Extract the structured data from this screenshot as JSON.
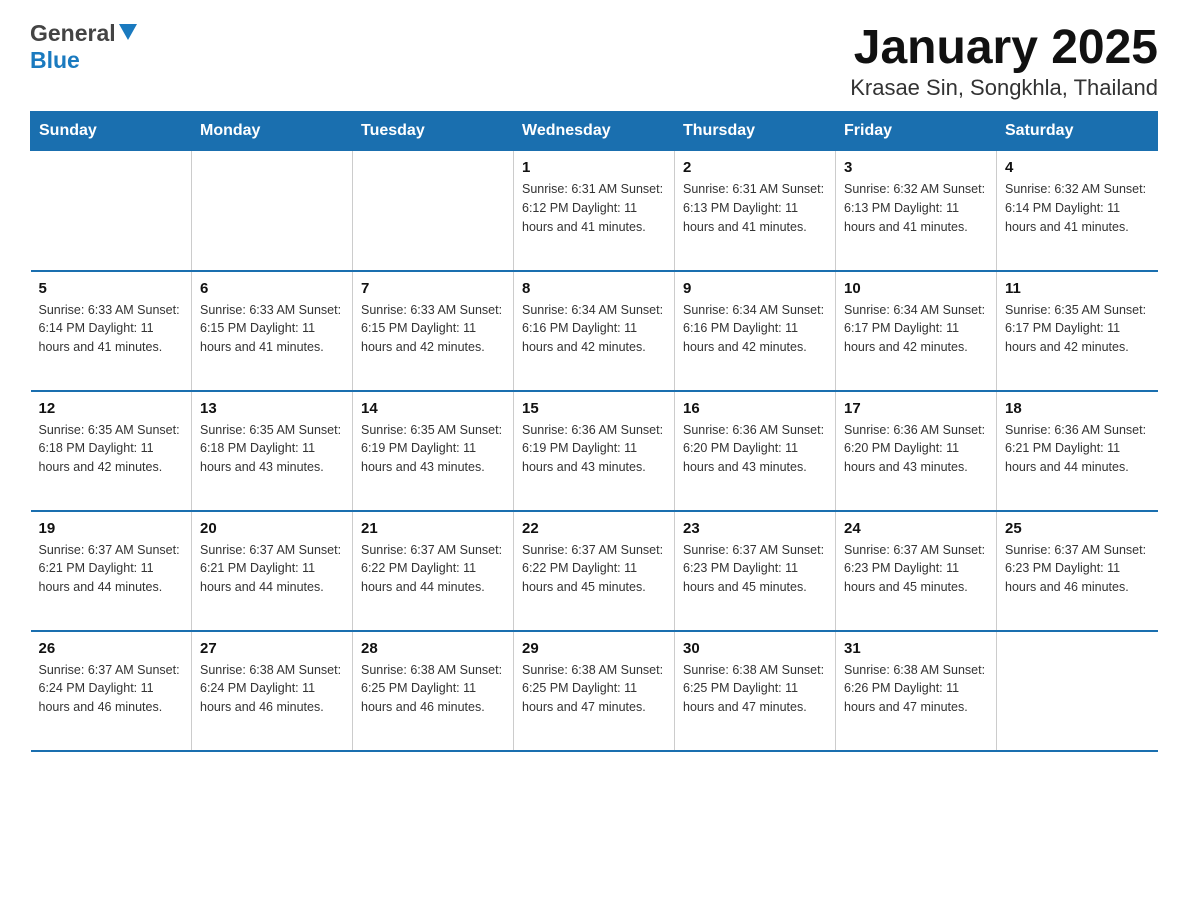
{
  "header": {
    "logo_general": "General",
    "logo_blue": "Blue",
    "title": "January 2025",
    "subtitle": "Krasae Sin, Songkhla, Thailand"
  },
  "days_of_week": [
    "Sunday",
    "Monday",
    "Tuesday",
    "Wednesday",
    "Thursday",
    "Friday",
    "Saturday"
  ],
  "weeks": [
    [
      {
        "day": "",
        "info": ""
      },
      {
        "day": "",
        "info": ""
      },
      {
        "day": "",
        "info": ""
      },
      {
        "day": "1",
        "info": "Sunrise: 6:31 AM\nSunset: 6:12 PM\nDaylight: 11 hours and 41 minutes."
      },
      {
        "day": "2",
        "info": "Sunrise: 6:31 AM\nSunset: 6:13 PM\nDaylight: 11 hours and 41 minutes."
      },
      {
        "day": "3",
        "info": "Sunrise: 6:32 AM\nSunset: 6:13 PM\nDaylight: 11 hours and 41 minutes."
      },
      {
        "day": "4",
        "info": "Sunrise: 6:32 AM\nSunset: 6:14 PM\nDaylight: 11 hours and 41 minutes."
      }
    ],
    [
      {
        "day": "5",
        "info": "Sunrise: 6:33 AM\nSunset: 6:14 PM\nDaylight: 11 hours and 41 minutes."
      },
      {
        "day": "6",
        "info": "Sunrise: 6:33 AM\nSunset: 6:15 PM\nDaylight: 11 hours and 41 minutes."
      },
      {
        "day": "7",
        "info": "Sunrise: 6:33 AM\nSunset: 6:15 PM\nDaylight: 11 hours and 42 minutes."
      },
      {
        "day": "8",
        "info": "Sunrise: 6:34 AM\nSunset: 6:16 PM\nDaylight: 11 hours and 42 minutes."
      },
      {
        "day": "9",
        "info": "Sunrise: 6:34 AM\nSunset: 6:16 PM\nDaylight: 11 hours and 42 minutes."
      },
      {
        "day": "10",
        "info": "Sunrise: 6:34 AM\nSunset: 6:17 PM\nDaylight: 11 hours and 42 minutes."
      },
      {
        "day": "11",
        "info": "Sunrise: 6:35 AM\nSunset: 6:17 PM\nDaylight: 11 hours and 42 minutes."
      }
    ],
    [
      {
        "day": "12",
        "info": "Sunrise: 6:35 AM\nSunset: 6:18 PM\nDaylight: 11 hours and 42 minutes."
      },
      {
        "day": "13",
        "info": "Sunrise: 6:35 AM\nSunset: 6:18 PM\nDaylight: 11 hours and 43 minutes."
      },
      {
        "day": "14",
        "info": "Sunrise: 6:35 AM\nSunset: 6:19 PM\nDaylight: 11 hours and 43 minutes."
      },
      {
        "day": "15",
        "info": "Sunrise: 6:36 AM\nSunset: 6:19 PM\nDaylight: 11 hours and 43 minutes."
      },
      {
        "day": "16",
        "info": "Sunrise: 6:36 AM\nSunset: 6:20 PM\nDaylight: 11 hours and 43 minutes."
      },
      {
        "day": "17",
        "info": "Sunrise: 6:36 AM\nSunset: 6:20 PM\nDaylight: 11 hours and 43 minutes."
      },
      {
        "day": "18",
        "info": "Sunrise: 6:36 AM\nSunset: 6:21 PM\nDaylight: 11 hours and 44 minutes."
      }
    ],
    [
      {
        "day": "19",
        "info": "Sunrise: 6:37 AM\nSunset: 6:21 PM\nDaylight: 11 hours and 44 minutes."
      },
      {
        "day": "20",
        "info": "Sunrise: 6:37 AM\nSunset: 6:21 PM\nDaylight: 11 hours and 44 minutes."
      },
      {
        "day": "21",
        "info": "Sunrise: 6:37 AM\nSunset: 6:22 PM\nDaylight: 11 hours and 44 minutes."
      },
      {
        "day": "22",
        "info": "Sunrise: 6:37 AM\nSunset: 6:22 PM\nDaylight: 11 hours and 45 minutes."
      },
      {
        "day": "23",
        "info": "Sunrise: 6:37 AM\nSunset: 6:23 PM\nDaylight: 11 hours and 45 minutes."
      },
      {
        "day": "24",
        "info": "Sunrise: 6:37 AM\nSunset: 6:23 PM\nDaylight: 11 hours and 45 minutes."
      },
      {
        "day": "25",
        "info": "Sunrise: 6:37 AM\nSunset: 6:23 PM\nDaylight: 11 hours and 46 minutes."
      }
    ],
    [
      {
        "day": "26",
        "info": "Sunrise: 6:37 AM\nSunset: 6:24 PM\nDaylight: 11 hours and 46 minutes."
      },
      {
        "day": "27",
        "info": "Sunrise: 6:38 AM\nSunset: 6:24 PM\nDaylight: 11 hours and 46 minutes."
      },
      {
        "day": "28",
        "info": "Sunrise: 6:38 AM\nSunset: 6:25 PM\nDaylight: 11 hours and 46 minutes."
      },
      {
        "day": "29",
        "info": "Sunrise: 6:38 AM\nSunset: 6:25 PM\nDaylight: 11 hours and 47 minutes."
      },
      {
        "day": "30",
        "info": "Sunrise: 6:38 AM\nSunset: 6:25 PM\nDaylight: 11 hours and 47 minutes."
      },
      {
        "day": "31",
        "info": "Sunrise: 6:38 AM\nSunset: 6:26 PM\nDaylight: 11 hours and 47 minutes."
      },
      {
        "day": "",
        "info": ""
      }
    ]
  ]
}
